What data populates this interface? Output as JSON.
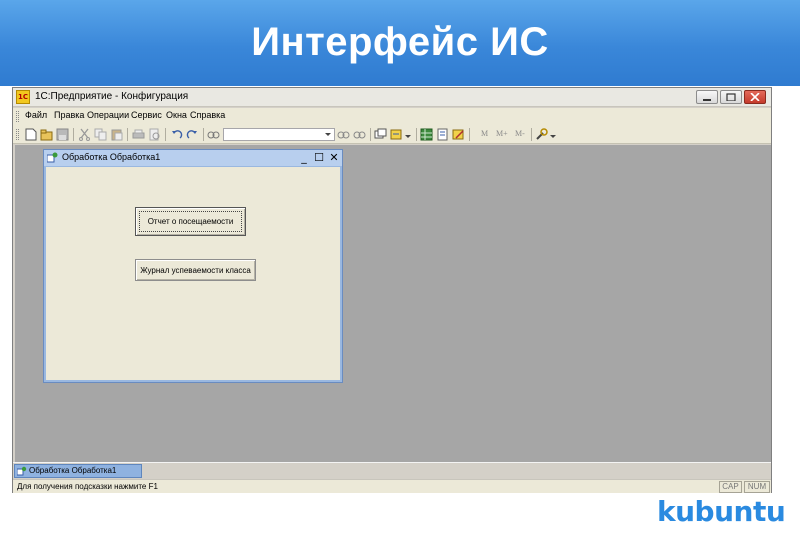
{
  "slide": {
    "title": "Интерфейс ИС",
    "brand": "kubuntu",
    "colors": {
      "banner": "#3a87d9",
      "brand": "#2a8ae0",
      "workspace": "#a6a6a6"
    }
  },
  "app": {
    "title": "1С:Предприятие - Конфигурация",
    "logo_text": "1С",
    "window_controls": [
      "minimize-icon",
      "maximize-icon",
      "close-icon"
    ],
    "menu": [
      "Файл",
      "Правка",
      "Операции",
      "Сервис",
      "Окна",
      "Справка"
    ],
    "toolbar": {
      "icons": [
        "new-document-icon",
        "open-folder-icon",
        "save-icon",
        "cut-icon",
        "copy-icon",
        "paste-icon",
        "print-icon",
        "print-preview-icon",
        "undo-icon",
        "redo-icon",
        "find-icon",
        "find-next-icon",
        "find-prev-icon",
        "window-icon",
        "module-icon",
        "table-icon",
        "text-icon",
        "edit-icon",
        "wrench-icon"
      ],
      "search_value": "",
      "text_buttons": [
        "M",
        "M+",
        "M-"
      ]
    },
    "child_window": {
      "title": "Обработка  Обработка1",
      "controls": [
        "_",
        "☐",
        "✕"
      ],
      "buttons": [
        {
          "label": "Отчет о посещаемости",
          "focused": true
        },
        {
          "label": "Журнал успеваемости класса",
          "focused": false
        }
      ]
    },
    "taskbar": {
      "item_label": "Обработка  Обработка1"
    },
    "status": {
      "text": "Для получения подсказки нажмите F1",
      "cap": "CAP",
      "num": "NUM"
    }
  }
}
